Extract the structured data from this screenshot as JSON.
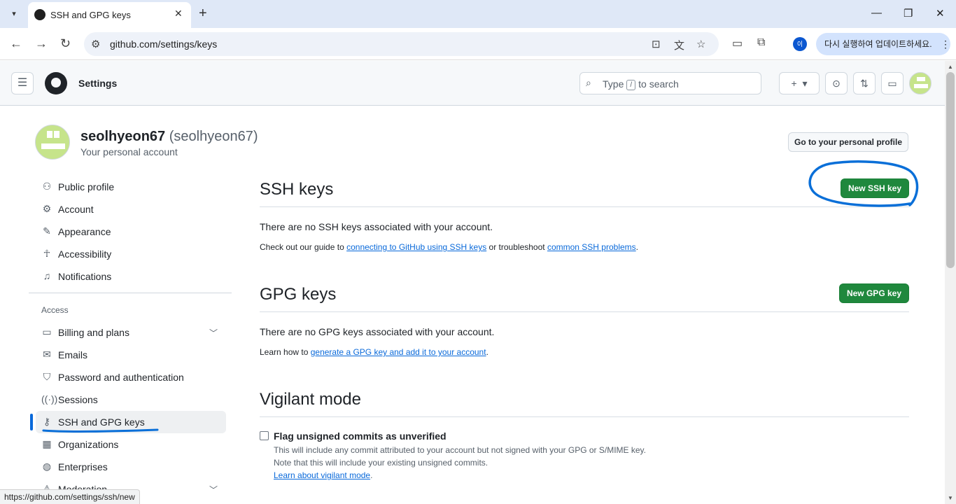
{
  "browser": {
    "tab_title": "SSH and GPG keys",
    "url": "github.com/settings/keys",
    "profile_initial": "이",
    "update_label": "다시 실행하여 업데이트하세요.",
    "status_url": "https://github.com/settings/ssh/new"
  },
  "header": {
    "context": "Settings",
    "search_placeholder_prefix": "Type",
    "search_key": "/",
    "search_placeholder_suffix": "to search"
  },
  "profile": {
    "name": "seolhyeon67",
    "login": "(seolhyeon67)",
    "subtitle": "Your personal account",
    "go_profile_button": "Go to your personal profile"
  },
  "sidebar": {
    "items": [
      {
        "label": "Public profile",
        "icon": "person-icon"
      },
      {
        "label": "Account",
        "icon": "gear-icon"
      },
      {
        "label": "Appearance",
        "icon": "paintbrush-icon"
      },
      {
        "label": "Accessibility",
        "icon": "accessibility-icon"
      },
      {
        "label": "Notifications",
        "icon": "bell-icon"
      }
    ],
    "access_heading": "Access",
    "access_items": [
      {
        "label": "Billing and plans",
        "icon": "credit-card-icon"
      },
      {
        "label": "Emails",
        "icon": "mail-icon"
      },
      {
        "label": "Password and authentication",
        "icon": "shield-lock-icon"
      },
      {
        "label": "Sessions",
        "icon": "broadcast-icon"
      },
      {
        "label": "SSH and GPG keys",
        "icon": "key-icon"
      },
      {
        "label": "Organizations",
        "icon": "organization-icon"
      },
      {
        "label": "Enterprises",
        "icon": "globe-icon"
      },
      {
        "label": "Moderation",
        "icon": "report-icon"
      }
    ]
  },
  "ssh": {
    "title": "SSH keys",
    "new_button": "New SSH key",
    "empty": "There are no SSH keys associated with your account.",
    "guide_prefix": "Check out our guide to",
    "guide_link": "connecting to GitHub using SSH keys",
    "guide_middle": "or troubleshoot",
    "guide_link2": "common SSH problems",
    "guide_suffix": "."
  },
  "gpg": {
    "title": "GPG keys",
    "new_button": "New GPG key",
    "empty": "There are no GPG keys associated with your account.",
    "learn_prefix": "Learn how to",
    "learn_link": "generate a GPG key and add it to your account",
    "learn_suffix": "."
  },
  "vigilant": {
    "title": "Vigilant mode",
    "checkbox_label": "Flag unsigned commits as unverified",
    "note1": "This will include any commit attributed to your account but not signed with your GPG or S/MIME key.",
    "note2": "Note that this will include your existing unsigned commits.",
    "learn_link": "Learn about vigilant mode",
    "learn_suffix": "."
  },
  "colors": {
    "primary_green": "#1f883d",
    "link_blue": "#0969da",
    "annotation_blue": "#0a6fd8"
  }
}
